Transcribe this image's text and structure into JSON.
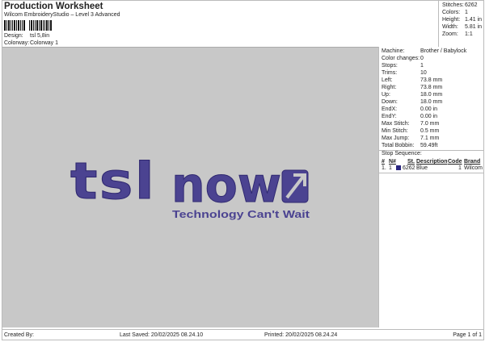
{
  "header": {
    "title": "Production Worksheet",
    "subtitle": "Wilcom EmbroideryStudio – Level 3 Advanced",
    "design_label": "Design:",
    "design_value": "tsl 5,8in",
    "colorway_label": "Colorway:",
    "colorway_value": "Colorway 1"
  },
  "stats": [
    {
      "label": "Stitches:",
      "value": "6262"
    },
    {
      "label": "Colors:",
      "value": "1"
    },
    {
      "label": "Height:",
      "value": "1.41 in"
    },
    {
      "label": "Width:",
      "value": "5.81 in"
    },
    {
      "label": "Zoom:",
      "value": "1:1"
    }
  ],
  "details": [
    {
      "label": "Machine:",
      "value": "Brother / Babylock"
    },
    {
      "label": "Color changes:",
      "value": "0"
    },
    {
      "label": "Stops:",
      "value": "1"
    },
    {
      "label": "Trims:",
      "value": "10"
    },
    {
      "label": "Left:",
      "value": "73.8 mm"
    },
    {
      "label": "Right:",
      "value": "73.8 mm"
    },
    {
      "label": "Up:",
      "value": "18.0 mm"
    },
    {
      "label": "Down:",
      "value": "18.0 mm"
    },
    {
      "label": "EndX:",
      "value": "0.00 in"
    },
    {
      "label": "EndY:",
      "value": "0.00 in"
    },
    {
      "label": "Max Stitch:",
      "value": "7.0 mm"
    },
    {
      "label": "Min Stitch:",
      "value": "0.5 mm"
    },
    {
      "label": "Max Jump:",
      "value": "7.1 mm"
    },
    {
      "label": "Total Bobbin:",
      "value": "59.49ft"
    }
  ],
  "stop_sequence": {
    "title": "Stop Sequence:",
    "headers": [
      "#",
      "N#",
      "St.",
      "Description",
      "Code",
      "Brand"
    ],
    "rows": [
      {
        "num": "1.",
        "n": "1",
        "color": "#2a2680",
        "st": "6262",
        "description": "Blue",
        "code": "1",
        "brand": "Wilcom"
      }
    ]
  },
  "design": {
    "logo_main_left": "tsl",
    "logo_main_right": "now",
    "tagline": "Technology  Can't  Wait",
    "thread_color": "#4b4391"
  },
  "footer": {
    "created_by": "Created By:",
    "last_saved": "Last Saved: 20/02/2025 08.24.10",
    "printed": "Printed: 20/02/2025 08.24.24",
    "page": "Page 1 of 1"
  }
}
